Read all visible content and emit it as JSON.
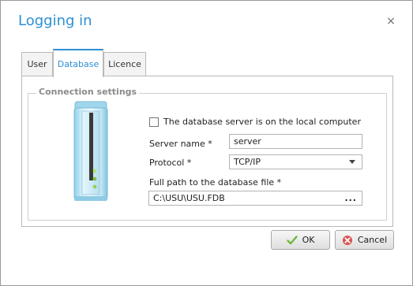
{
  "dialog": {
    "title": "Logging in",
    "close_glyph": "×"
  },
  "tabs": [
    {
      "label": "User",
      "active": false
    },
    {
      "label": "Database",
      "active": true
    },
    {
      "label": "Licence",
      "active": false
    }
  ],
  "connection": {
    "group_title": "Connection settings",
    "local_server_checkbox": {
      "label": "The database server is on the local computer",
      "checked": false
    },
    "server_name": {
      "label": "Server name *",
      "value": "server"
    },
    "protocol": {
      "label": "Protocol *",
      "value": "TCP/IP"
    },
    "db_path": {
      "label": "Full path to the database file *",
      "value": "C:\\USU\\USU.FDB",
      "browse_label": "..."
    }
  },
  "buttons": {
    "ok": {
      "label": "OK",
      "icon": "checkmark-icon"
    },
    "cancel": {
      "label": "Cancel",
      "icon": "cancel-icon"
    }
  },
  "colors": {
    "accent": "#2e8fd3",
    "ok_icon": "#6fb63a",
    "cancel_icon": "#d9534f"
  }
}
